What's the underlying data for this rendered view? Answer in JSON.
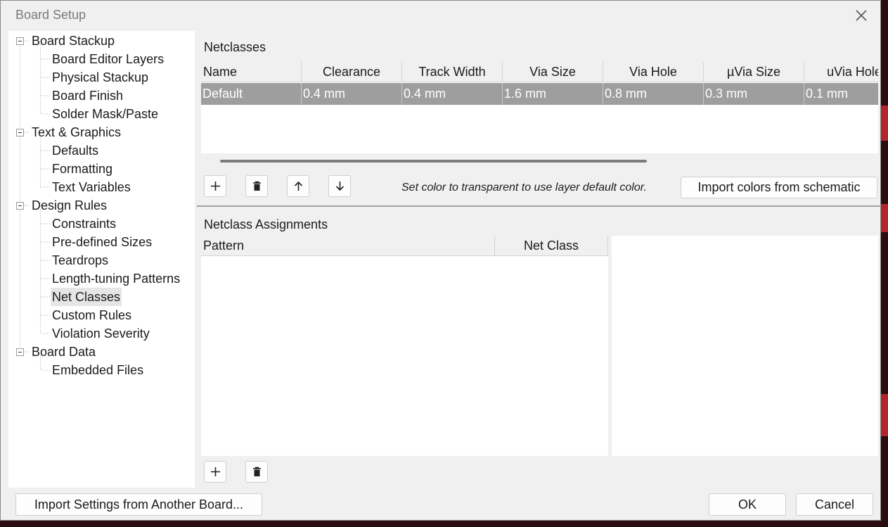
{
  "dialog": {
    "title": "Board Setup"
  },
  "tree": {
    "items": [
      {
        "label": "Board Stackup"
      },
      {
        "label": "Board Editor Layers"
      },
      {
        "label": "Physical Stackup"
      },
      {
        "label": "Board Finish"
      },
      {
        "label": "Solder Mask/Paste"
      },
      {
        "label": "Text & Graphics"
      },
      {
        "label": "Defaults"
      },
      {
        "label": "Formatting"
      },
      {
        "label": "Text Variables"
      },
      {
        "label": "Design Rules"
      },
      {
        "label": "Constraints"
      },
      {
        "label": "Pre-defined Sizes"
      },
      {
        "label": "Teardrops"
      },
      {
        "label": "Length-tuning Patterns"
      },
      {
        "label": "Net Classes"
      },
      {
        "label": "Custom Rules"
      },
      {
        "label": "Violation Severity"
      },
      {
        "label": "Board Data"
      },
      {
        "label": "Embedded Files"
      }
    ],
    "selected": "Net Classes"
  },
  "netclasses": {
    "section_title": "Netclasses",
    "columns": [
      "Name",
      "Clearance",
      "Track Width",
      "Via Size",
      "Via Hole",
      "µVia Size",
      "uVia Hole"
    ],
    "rows": [
      [
        "Default",
        "0.4 mm",
        "0.4 mm",
        "1.6 mm",
        "0.8 mm",
        "0.3 mm",
        "0.1 mm"
      ]
    ],
    "hint": "Set color to transparent to use layer default color.",
    "import_colors_label": "Import colors from schematic"
  },
  "assignments": {
    "section_title": "Netclass Assignments",
    "columns": [
      "Pattern",
      "Net Class"
    ]
  },
  "footer": {
    "import_settings_label": "Import Settings from Another Board...",
    "ok_label": "OK",
    "cancel_label": "Cancel"
  },
  "icons": {
    "close": "close-icon",
    "add": "plus-icon",
    "delete": "trash-icon",
    "up": "arrow-up-icon",
    "down": "arrow-down-icon"
  },
  "colors": {
    "selected_row": "#9e9e9e",
    "dialog_bg": "#f0f0f0",
    "background_board": "#2a0d10"
  }
}
